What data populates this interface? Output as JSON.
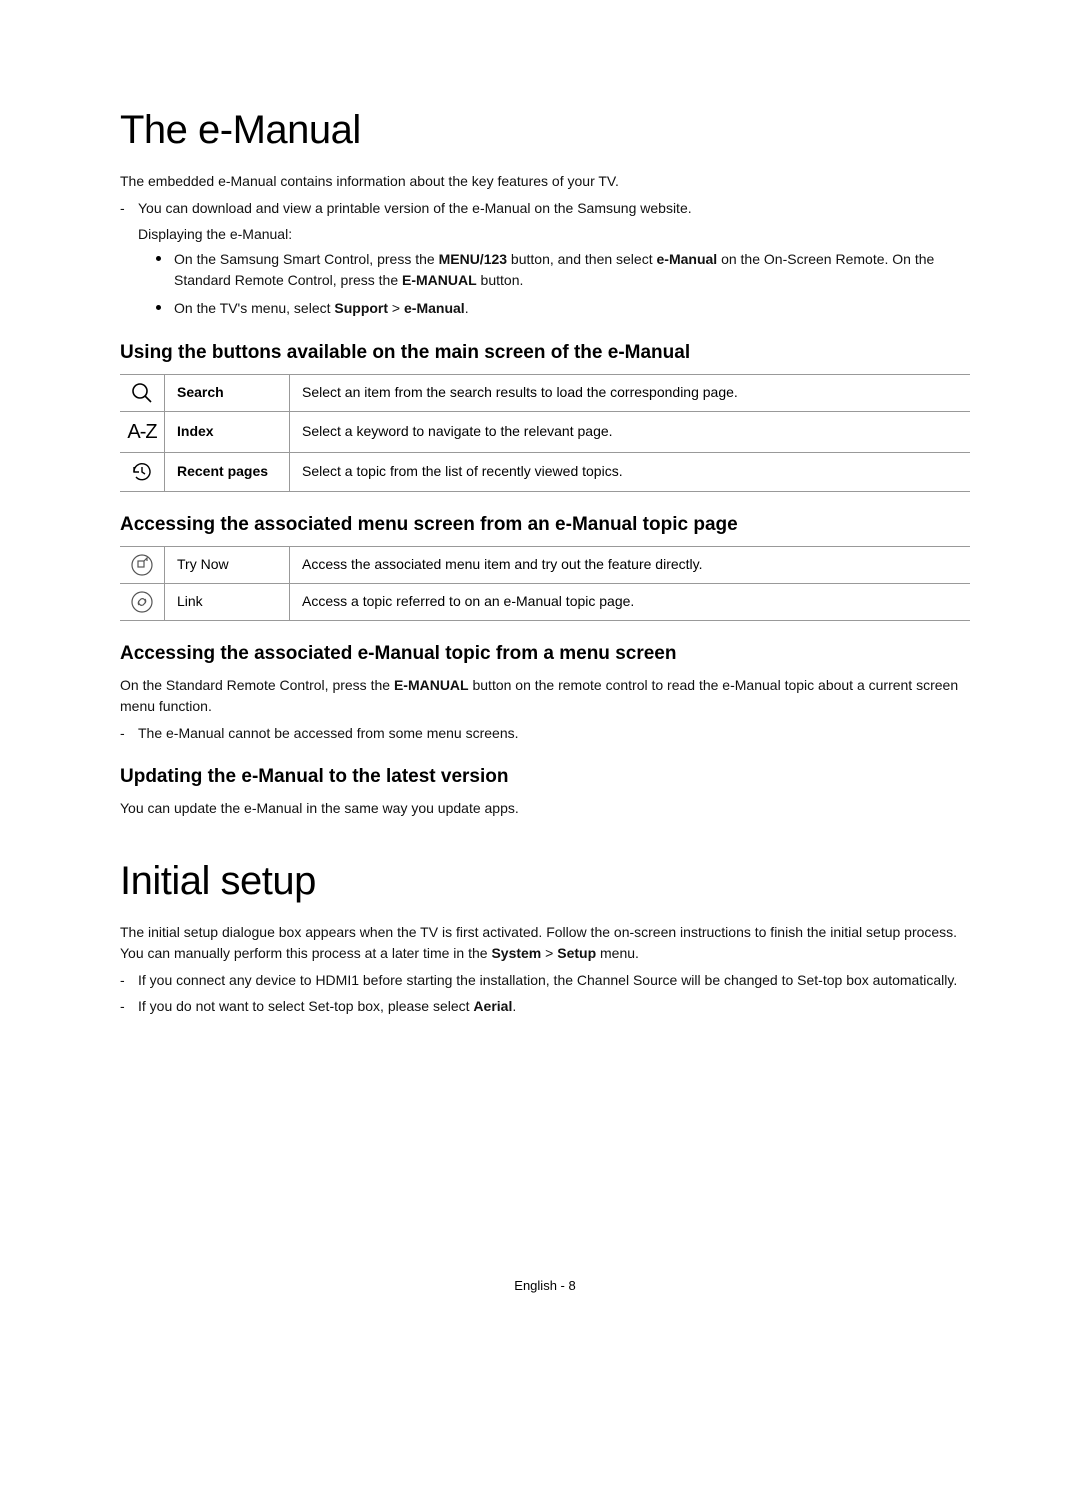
{
  "section1": {
    "title": "The e-Manual",
    "intro": "The embedded e-Manual contains information about the key features of your TV.",
    "dash1": "You can download and view a printable version of the e-Manual on the Samsung website.",
    "displaying": "Displaying the e-Manual:",
    "bullet1_pre": "On the Samsung Smart Control, press the ",
    "bullet1_b1": "MENU/123",
    "bullet1_mid": " button, and then select ",
    "bullet1_b2": "e-Manual",
    "bullet1_post": " on the On-Screen Remote. On the Standard Remote Control, press the ",
    "bullet1_b3": "E-MANUAL",
    "bullet1_end": " button.",
    "bullet2_pre": "On the TV's menu, select ",
    "bullet2_b1": "Support",
    "bullet2_gt": " > ",
    "bullet2_b2": "e-Manual",
    "bullet2_end": "."
  },
  "sub1": {
    "heading": "Using the buttons available on the main screen of the e-Manual",
    "rows": [
      {
        "label": "Search",
        "desc": "Select an item from the search results to load the corresponding page."
      },
      {
        "label": "Index",
        "desc": "Select a keyword to navigate to the relevant page."
      },
      {
        "label": "Recent pages",
        "desc": "Select a topic from the list of recently viewed topics."
      }
    ]
  },
  "sub2": {
    "heading": "Accessing the associated menu screen from an e-Manual topic page",
    "rows": [
      {
        "label": "Try Now",
        "desc": "Access the associated menu item and try out the feature directly."
      },
      {
        "label": "Link",
        "desc": "Access a topic referred to on an e-Manual topic page."
      }
    ]
  },
  "sub3": {
    "heading": "Accessing the associated e-Manual topic from a menu screen",
    "p_pre": "On the Standard Remote Control, press the ",
    "p_b": "E-MANUAL",
    "p_post": " button on the remote control to read the e-Manual topic about a current screen menu function.",
    "dash": "The e-Manual cannot be accessed from some menu screens."
  },
  "sub4": {
    "heading": "Updating the e-Manual to the latest version",
    "p": "You can update the e-Manual in the same way you update apps."
  },
  "section2": {
    "title": "Initial setup",
    "intro_pre": "The initial setup dialogue box appears when the TV is first activated. Follow the on-screen instructions to finish the initial setup process. You can manually perform this process at a later time in the ",
    "intro_b1": "System",
    "intro_gt": " > ",
    "intro_b2": "Setup",
    "intro_post": " menu.",
    "dash1": "If you connect any device to HDMI1 before starting the installation, the Channel Source will be changed to Set-top box automatically.",
    "dash2_pre": "If you do not want to select Set-top box, please select ",
    "dash2_b": "Aerial",
    "dash2_end": "."
  },
  "footer": "English - 8",
  "icons": {
    "index_label": "A-Z"
  }
}
